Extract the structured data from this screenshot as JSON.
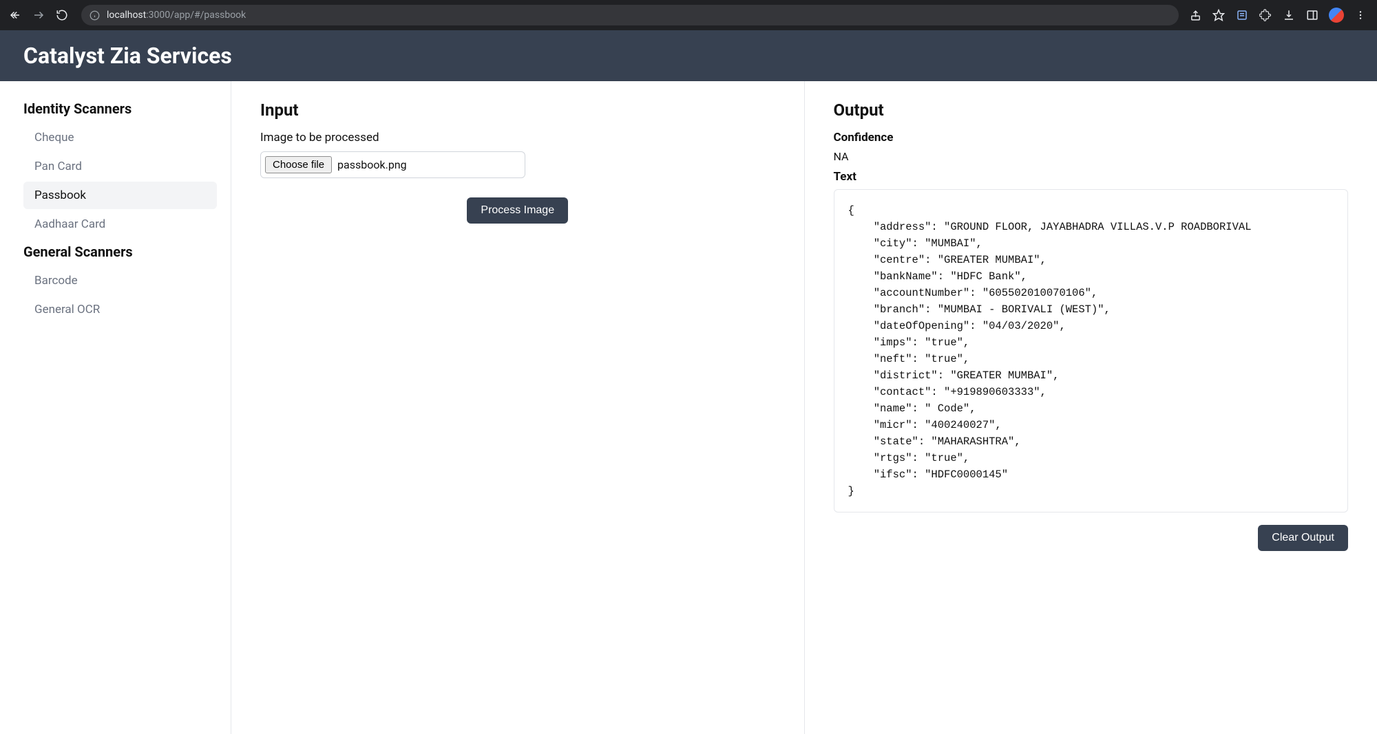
{
  "browser": {
    "url_host": "localhost",
    "url_rest": ":3000/app/#/passbook"
  },
  "header": {
    "title": "Catalyst Zia Services"
  },
  "sidebar": {
    "groups": [
      {
        "title": "Identity Scanners",
        "items": [
          {
            "label": "Cheque",
            "active": false
          },
          {
            "label": "Pan Card",
            "active": false
          },
          {
            "label": "Passbook",
            "active": true
          },
          {
            "label": "Aadhaar Card",
            "active": false
          }
        ]
      },
      {
        "title": "General Scanners",
        "items": [
          {
            "label": "Barcode",
            "active": false
          },
          {
            "label": "General OCR",
            "active": false
          }
        ]
      }
    ]
  },
  "input": {
    "heading": "Input",
    "field_label": "Image to be processed",
    "choose_label": "Choose file",
    "file_name": "passbook.png",
    "process_label": "Process Image"
  },
  "output": {
    "heading": "Output",
    "confidence_label": "Confidence",
    "confidence_value": "NA",
    "text_label": "Text",
    "json_text": "{\n    \"address\": \"GROUND FLOOR, JAYABHADRA VILLAS.V.P ROADBORIVAL\n    \"city\": \"MUMBAI\",\n    \"centre\": \"GREATER MUMBAI\",\n    \"bankName\": \"HDFC Bank\",\n    \"accountNumber\": \"605502010070106\",\n    \"branch\": \"MUMBAI - BORIVALI (WEST)\",\n    \"dateOfOpening\": \"04/03/2020\",\n    \"imps\": \"true\",\n    \"neft\": \"true\",\n    \"district\": \"GREATER MUMBAI\",\n    \"contact\": \"+919890603333\",\n    \"name\": \" Code\",\n    \"micr\": \"400240027\",\n    \"state\": \"MAHARASHTRA\",\n    \"rtgs\": \"true\",\n    \"ifsc\": \"HDFC0000145\"\n}",
    "clear_label": "Clear Output"
  }
}
